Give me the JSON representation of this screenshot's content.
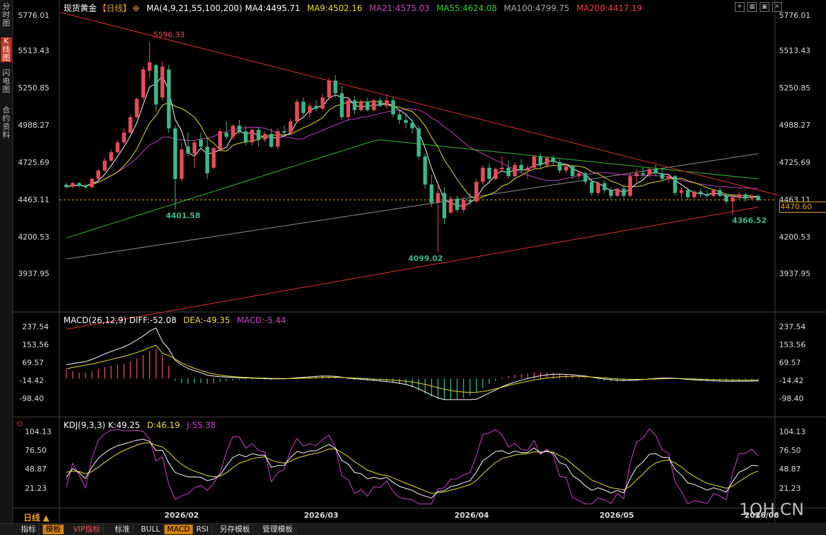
{
  "side_tabs": [
    {
      "label": "分\n时\n图",
      "active": false
    },
    {
      "label": "K\n线\n图",
      "active": true
    },
    {
      "label": "闪\n电\n图",
      "active": false
    },
    {
      "label": "合\n约\n资\n料",
      "active": false
    }
  ],
  "header": {
    "instrument": "现货黄金",
    "period": "【日线】",
    "ma_params": "MA(4,9,21,55,100,200)",
    "ma4": "MA4:4495.71",
    "ma9": "MA9:4502.16",
    "ma21": "MA21:4575.03",
    "ma55": "MA55:4624.08",
    "ma100": "MA100:4799.75",
    "ma200": "MA200:4417.19"
  },
  "macd_header": {
    "params": "MACD(26,12,9)",
    "diff": "DIFF:-52.08",
    "dea": "DEA:-49.35",
    "macd": "MACD:-5.44"
  },
  "kdj_header": {
    "params": "KDJ(9,3,3)",
    "k": "K:49.25",
    "d": "D:46.19",
    "j": "J:55.38"
  },
  "price_axis": [
    "5776.01",
    "5513.43",
    "5250.85",
    "4988.27",
    "4725.69",
    "4463.11",
    "4200.53",
    "3937.95"
  ],
  "current_price": "4470.60",
  "macd_axis": [
    "237.54",
    "153.56",
    "69.57",
    "-14.42",
    "-98.40"
  ],
  "kdj_axis": [
    "104.13",
    "76.50",
    "48.87",
    "21.23"
  ],
  "x_axis": [
    "2026/02",
    "2026/03",
    "2026/04",
    "2026/05",
    "2026/06"
  ],
  "annotations": {
    "high": "5596.33",
    "low1": "4401.58",
    "low2": "4099.02",
    "low3": "4366.52"
  },
  "period_label": "日线 ▲",
  "watermark": "1QH.CN",
  "bottom_tabs": [
    "指标",
    "模板",
    "VIP指标",
    "标准",
    "BULL",
    "MACD",
    "RSI",
    "另存模板",
    "管理模板"
  ],
  "colors": {
    "up": "#e84b5a",
    "down": "#3ab88a",
    "ma4": "#ffffff",
    "ma9": "#e8e030",
    "ma21": "#c040c0",
    "ma55": "#30c030",
    "ma100": "#909090",
    "ma200": "#e03030"
  },
  "chart_data": {
    "type": "candlestick",
    "x_labels": [
      "2026/02",
      "2026/03",
      "2026/04",
      "2026/05",
      "2026/06"
    ],
    "ylim": [
      3900,
      5800
    ],
    "candles": [
      {
        "o": 4580,
        "h": 4595,
        "l": 4555,
        "c": 4562
      },
      {
        "o": 4565,
        "h": 4600,
        "l": 4555,
        "c": 4590
      },
      {
        "o": 4590,
        "h": 4598,
        "l": 4560,
        "c": 4570
      },
      {
        "o": 4575,
        "h": 4585,
        "l": 4550,
        "c": 4560
      },
      {
        "o": 4560,
        "h": 4630,
        "l": 4555,
        "c": 4620
      },
      {
        "o": 4620,
        "h": 4690,
        "l": 4610,
        "c": 4680
      },
      {
        "o": 4680,
        "h": 4770,
        "l": 4670,
        "c": 4750
      },
      {
        "o": 4750,
        "h": 4830,
        "l": 4740,
        "c": 4810
      },
      {
        "o": 4810,
        "h": 4900,
        "l": 4800,
        "c": 4880
      },
      {
        "o": 4880,
        "h": 4980,
        "l": 4870,
        "c": 4950
      },
      {
        "o": 4950,
        "h": 5080,
        "l": 4940,
        "c": 5060
      },
      {
        "o": 5060,
        "h": 5200,
        "l": 5050,
        "c": 5190
      },
      {
        "o": 5200,
        "h": 5420,
        "l": 5180,
        "c": 5400
      },
      {
        "o": 5390,
        "h": 5596,
        "l": 5340,
        "c": 5450
      },
      {
        "o": 5430,
        "h": 5440,
        "l": 5100,
        "c": 5150
      },
      {
        "o": 5200,
        "h": 5460,
        "l": 5180,
        "c": 5420
      },
      {
        "o": 5400,
        "h": 5430,
        "l": 4950,
        "c": 4980
      },
      {
        "o": 4980,
        "h": 5000,
        "l": 4402,
        "c": 4620
      },
      {
        "o": 4620,
        "h": 4880,
        "l": 4600,
        "c": 4830
      },
      {
        "o": 4850,
        "h": 4950,
        "l": 4780,
        "c": 4800
      },
      {
        "o": 4800,
        "h": 4900,
        "l": 4700,
        "c": 4880
      },
      {
        "o": 4900,
        "h": 4950,
        "l": 4830,
        "c": 4850
      },
      {
        "o": 4850,
        "h": 4920,
        "l": 4620,
        "c": 4660
      },
      {
        "o": 4700,
        "h": 4850,
        "l": 4690,
        "c": 4840
      },
      {
        "o": 4830,
        "h": 4980,
        "l": 4810,
        "c": 4960
      },
      {
        "o": 4950,
        "h": 5030,
        "l": 4900,
        "c": 4920
      },
      {
        "o": 4920,
        "h": 5010,
        "l": 4900,
        "c": 5000
      },
      {
        "o": 5000,
        "h": 5040,
        "l": 4940,
        "c": 4960
      },
      {
        "o": 4960,
        "h": 5000,
        "l": 4860,
        "c": 4880
      },
      {
        "o": 4880,
        "h": 4980,
        "l": 4860,
        "c": 4970
      },
      {
        "o": 4970,
        "h": 4990,
        "l": 4850,
        "c": 4900
      },
      {
        "o": 4900,
        "h": 4960,
        "l": 4880,
        "c": 4940
      },
      {
        "o": 4940,
        "h": 4980,
        "l": 4840,
        "c": 4850
      },
      {
        "o": 4850,
        "h": 4980,
        "l": 4830,
        "c": 4960
      },
      {
        "o": 4960,
        "h": 5000,
        "l": 4930,
        "c": 4950
      },
      {
        "o": 4950,
        "h": 5050,
        "l": 4940,
        "c": 5030
      },
      {
        "o": 5030,
        "h": 5190,
        "l": 5020,
        "c": 5170
      },
      {
        "o": 5170,
        "h": 5200,
        "l": 5070,
        "c": 5090
      },
      {
        "o": 5090,
        "h": 5160,
        "l": 5060,
        "c": 5140
      },
      {
        "o": 5140,
        "h": 5180,
        "l": 5100,
        "c": 5120
      },
      {
        "o": 5120,
        "h": 5230,
        "l": 5110,
        "c": 5200
      },
      {
        "o": 5200,
        "h": 5340,
        "l": 5180,
        "c": 5320
      },
      {
        "o": 5320,
        "h": 5360,
        "l": 5200,
        "c": 5230
      },
      {
        "o": 5230,
        "h": 5280,
        "l": 5040,
        "c": 5060
      },
      {
        "o": 5060,
        "h": 5200,
        "l": 5040,
        "c": 5180
      },
      {
        "o": 5180,
        "h": 5210,
        "l": 5080,
        "c": 5110
      },
      {
        "o": 5110,
        "h": 5190,
        "l": 5100,
        "c": 5170
      },
      {
        "o": 5170,
        "h": 5200,
        "l": 5100,
        "c": 5110
      },
      {
        "o": 5110,
        "h": 5190,
        "l": 5100,
        "c": 5180
      },
      {
        "o": 5180,
        "h": 5200,
        "l": 5130,
        "c": 5140
      },
      {
        "o": 5140,
        "h": 5220,
        "l": 5120,
        "c": 5180
      },
      {
        "o": 5180,
        "h": 5200,
        "l": 5060,
        "c": 5080
      },
      {
        "o": 5080,
        "h": 5110,
        "l": 5010,
        "c": 5040
      },
      {
        "o": 5040,
        "h": 5090,
        "l": 4980,
        "c": 5020
      },
      {
        "o": 5020,
        "h": 5050,
        "l": 4940,
        "c": 4980
      },
      {
        "o": 4980,
        "h": 5000,
        "l": 4760,
        "c": 4780
      },
      {
        "o": 4780,
        "h": 4800,
        "l": 4550,
        "c": 4580
      },
      {
        "o": 4580,
        "h": 4650,
        "l": 4420,
        "c": 4450
      },
      {
        "o": 4450,
        "h": 4600,
        "l": 4099,
        "c": 4520
      },
      {
        "o": 4520,
        "h": 4560,
        "l": 4300,
        "c": 4340
      },
      {
        "o": 4380,
        "h": 4500,
        "l": 4370,
        "c": 4480
      },
      {
        "o": 4480,
        "h": 4500,
        "l": 4380,
        "c": 4400
      },
      {
        "o": 4400,
        "h": 4490,
        "l": 4380,
        "c": 4470
      },
      {
        "o": 4470,
        "h": 4520,
        "l": 4440,
        "c": 4460
      },
      {
        "o": 4460,
        "h": 4620,
        "l": 4450,
        "c": 4600
      },
      {
        "o": 4600,
        "h": 4720,
        "l": 4580,
        "c": 4700
      },
      {
        "o": 4700,
        "h": 4730,
        "l": 4600,
        "c": 4620
      },
      {
        "o": 4620,
        "h": 4700,
        "l": 4610,
        "c": 4690
      },
      {
        "o": 4690,
        "h": 4780,
        "l": 4680,
        "c": 4700
      },
      {
        "o": 4700,
        "h": 4750,
        "l": 4620,
        "c": 4640
      },
      {
        "o": 4640,
        "h": 4740,
        "l": 4630,
        "c": 4720
      },
      {
        "o": 4720,
        "h": 4760,
        "l": 4660,
        "c": 4680
      },
      {
        "o": 4680,
        "h": 4720,
        "l": 4620,
        "c": 4700
      },
      {
        "o": 4700,
        "h": 4790,
        "l": 4690,
        "c": 4780
      },
      {
        "o": 4780,
        "h": 4800,
        "l": 4700,
        "c": 4720
      },
      {
        "o": 4720,
        "h": 4780,
        "l": 4700,
        "c": 4770
      },
      {
        "o": 4770,
        "h": 4790,
        "l": 4720,
        "c": 4740
      },
      {
        "o": 4740,
        "h": 4760,
        "l": 4660,
        "c": 4680
      },
      {
        "o": 4680,
        "h": 4730,
        "l": 4660,
        "c": 4710
      },
      {
        "o": 4710,
        "h": 4720,
        "l": 4620,
        "c": 4640
      },
      {
        "o": 4640,
        "h": 4680,
        "l": 4620,
        "c": 4660
      },
      {
        "o": 4660,
        "h": 4670,
        "l": 4580,
        "c": 4600
      },
      {
        "o": 4600,
        "h": 4620,
        "l": 4500,
        "c": 4520
      },
      {
        "o": 4520,
        "h": 4600,
        "l": 4500,
        "c": 4590
      },
      {
        "o": 4590,
        "h": 4610,
        "l": 4520,
        "c": 4540
      },
      {
        "o": 4540,
        "h": 4560,
        "l": 4480,
        "c": 4500
      },
      {
        "o": 4500,
        "h": 4560,
        "l": 4490,
        "c": 4550
      },
      {
        "o": 4550,
        "h": 4580,
        "l": 4480,
        "c": 4500
      },
      {
        "o": 4500,
        "h": 4660,
        "l": 4490,
        "c": 4640
      },
      {
        "o": 4640,
        "h": 4690,
        "l": 4600,
        "c": 4660
      },
      {
        "o": 4660,
        "h": 4700,
        "l": 4630,
        "c": 4650
      },
      {
        "o": 4650,
        "h": 4700,
        "l": 4630,
        "c": 4690
      },
      {
        "o": 4690,
        "h": 4720,
        "l": 4640,
        "c": 4660
      },
      {
        "o": 4660,
        "h": 4700,
        "l": 4600,
        "c": 4620
      },
      {
        "o": 4620,
        "h": 4660,
        "l": 4590,
        "c": 4640
      },
      {
        "o": 4640,
        "h": 4650,
        "l": 4500,
        "c": 4520
      },
      {
        "o": 4520,
        "h": 4560,
        "l": 4480,
        "c": 4540
      },
      {
        "o": 4540,
        "h": 4560,
        "l": 4470,
        "c": 4490
      },
      {
        "o": 4490,
        "h": 4540,
        "l": 4480,
        "c": 4530
      },
      {
        "o": 4530,
        "h": 4550,
        "l": 4490,
        "c": 4510
      },
      {
        "o": 4510,
        "h": 4540,
        "l": 4480,
        "c": 4500
      },
      {
        "o": 4500,
        "h": 4550,
        "l": 4490,
        "c": 4540
      },
      {
        "o": 4540,
        "h": 4560,
        "l": 4490,
        "c": 4500
      },
      {
        "o": 4500,
        "h": 4520,
        "l": 4440,
        "c": 4460
      },
      {
        "o": 4460,
        "h": 4510,
        "l": 4367,
        "c": 4490
      },
      {
        "o": 4490,
        "h": 4530,
        "l": 4470,
        "c": 4510
      },
      {
        "o": 4510,
        "h": 4520,
        "l": 4460,
        "c": 4480
      },
      {
        "o": 4480,
        "h": 4510,
        "l": 4470,
        "c": 4500
      },
      {
        "o": 4500,
        "h": 4510,
        "l": 4460,
        "c": 4470
      }
    ],
    "macd_hist": [
      40,
      35,
      30,
      28,
      35,
      45,
      55,
      60,
      65,
      70,
      80,
      95,
      110,
      130,
      140,
      110,
      60,
      -10,
      -20,
      -25,
      -22,
      -20,
      -25,
      -20,
      -15,
      -10,
      -8,
      -6,
      -5,
      -4,
      -3,
      -4,
      -5,
      -3,
      -2,
      2,
      6,
      8,
      10,
      12,
      14,
      12,
      8,
      2,
      -4,
      -6,
      -8,
      -10,
      -12,
      -14,
      -16,
      -20,
      -25,
      -30,
      -40,
      -55,
      -70,
      -85,
      -95,
      -100,
      -98,
      -95,
      -90,
      -80,
      -65,
      -45,
      -25,
      -10,
      5,
      12,
      18,
      22,
      25,
      28,
      30,
      30,
      28,
      25,
      20,
      15,
      10,
      5,
      -2,
      -6,
      -10,
      -12,
      -14,
      -12,
      -10,
      -6,
      -2,
      2,
      5,
      6,
      5,
      3,
      -2,
      -6,
      -8,
      -9,
      -10,
      -11,
      -12,
      -12,
      -11,
      -10,
      -9,
      -8,
      -7,
      -6
    ]
  }
}
